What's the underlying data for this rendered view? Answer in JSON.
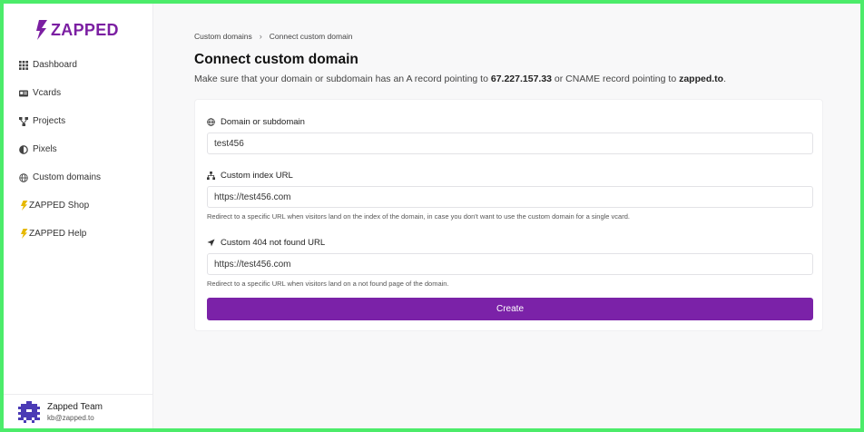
{
  "brand": {
    "name": "ZAPPED",
    "color": "#7b1fa2"
  },
  "sidebar": {
    "items": [
      {
        "label": "Dashboard",
        "icon": "grid-icon"
      },
      {
        "label": "Vcards",
        "icon": "id-card-icon"
      },
      {
        "label": "Projects",
        "icon": "sitemap-icon"
      },
      {
        "label": "Pixels",
        "icon": "half-circle-icon"
      },
      {
        "label": "Custom domains",
        "icon": "globe-icon"
      },
      {
        "label": "ZAPPED Shop",
        "icon": "bolt-icon"
      },
      {
        "label": "ZAPPED Help",
        "icon": "bolt-icon"
      }
    ],
    "user": {
      "name": "Zapped Team",
      "email": "kb@zapped.to"
    }
  },
  "breadcrumb": {
    "parent": "Custom domains",
    "separator": "›",
    "current": "Connect custom domain"
  },
  "page": {
    "title": "Connect custom domain",
    "desc_prefix": "Make sure that your domain or subdomain has an A record pointing to ",
    "ip": "67.227.157.33",
    "desc_middle": " or CNAME record pointing to ",
    "cname": "zapped.to",
    "desc_suffix": "."
  },
  "form": {
    "domain": {
      "label": "Domain or subdomain",
      "value": "test456",
      "icon": "globe-icon"
    },
    "index_url": {
      "label": "Custom index URL",
      "value": "https://test456.com",
      "icon": "sitemap-icon",
      "help": "Redirect to a specific URL when visitors land on the index of the domain, in case you don't want to use the custom domain for a single vcard."
    },
    "not_found_url": {
      "label": "Custom 404 not found URL",
      "value": "https://test456.com",
      "icon": "location-arrow-icon",
      "help": "Redirect to a specific URL when visitors land on a not found page of the domain."
    },
    "submit_label": "Create",
    "accent": "#7b22a8"
  }
}
